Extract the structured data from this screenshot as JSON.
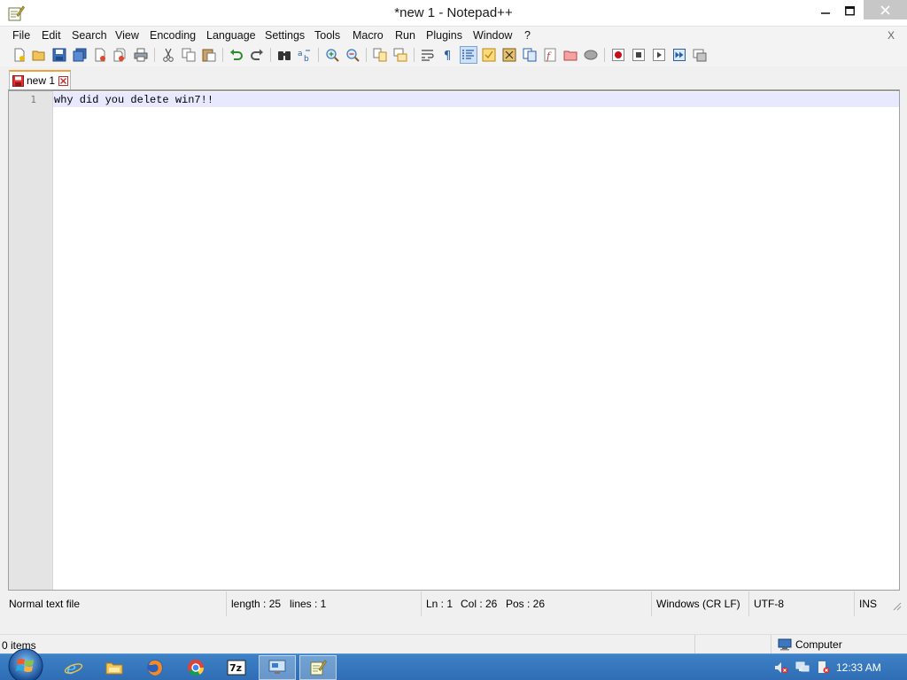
{
  "window": {
    "title": "*new 1 - Notepad++"
  },
  "menu": {
    "items": [
      "File",
      "Edit",
      "Search",
      "View",
      "Encoding",
      "Language",
      "Settings",
      "Tools",
      "Macro",
      "Run",
      "Plugins",
      "Window",
      "?"
    ],
    "close_glyph": "X"
  },
  "toolbar": {
    "icons": [
      "new-file-icon",
      "open-file-icon",
      "save-icon",
      "save-all-icon",
      "close-icon",
      "close-all-icon",
      "print-icon",
      "cut-icon",
      "copy-icon",
      "paste-icon",
      "undo-icon",
      "redo-icon",
      "find-icon",
      "replace-icon",
      "zoom-in-icon",
      "zoom-out-icon",
      "sync-vertical-icon",
      "sync-horizontal-icon",
      "word-wrap-icon",
      "show-all-chars-icon",
      "indent-guide-icon",
      "udl-icon",
      "doc-map-icon",
      "function-list-icon",
      "folder-as-workspace-icon",
      "monitoring-icon",
      "macro-record-icon",
      "macro-stop-icon",
      "macro-play-icon",
      "macro-run-multiple-icon",
      "macro-save-icon"
    ]
  },
  "tabs": [
    {
      "label": "new 1"
    }
  ],
  "editor": {
    "line_number": "1",
    "line_text": "why did you delete win7!!"
  },
  "status": {
    "file_type": "Normal text file",
    "length": "length : 25",
    "lines": "lines : 1",
    "ln": "Ln : 1",
    "col": "Col : 26",
    "pos": "Pos : 26",
    "eol": "Windows (CR LF)",
    "encoding": "UTF-8",
    "mode": "INS"
  },
  "explorer": {
    "items_count": "0 items",
    "zone": "Computer"
  },
  "taskbar": {
    "apps": [
      "internet-explorer-icon",
      "file-explorer-icon",
      "firefox-icon",
      "chrome-icon",
      "7zip-icon",
      "remote-desktop-icon",
      "notepadpp-icon"
    ],
    "seven_zip_label": "7z",
    "clock": "12:33 AM"
  },
  "colors": {
    "current_line": "#e8e8ff",
    "tab_accent": "#f0a13c",
    "taskbar": "#3277be"
  }
}
